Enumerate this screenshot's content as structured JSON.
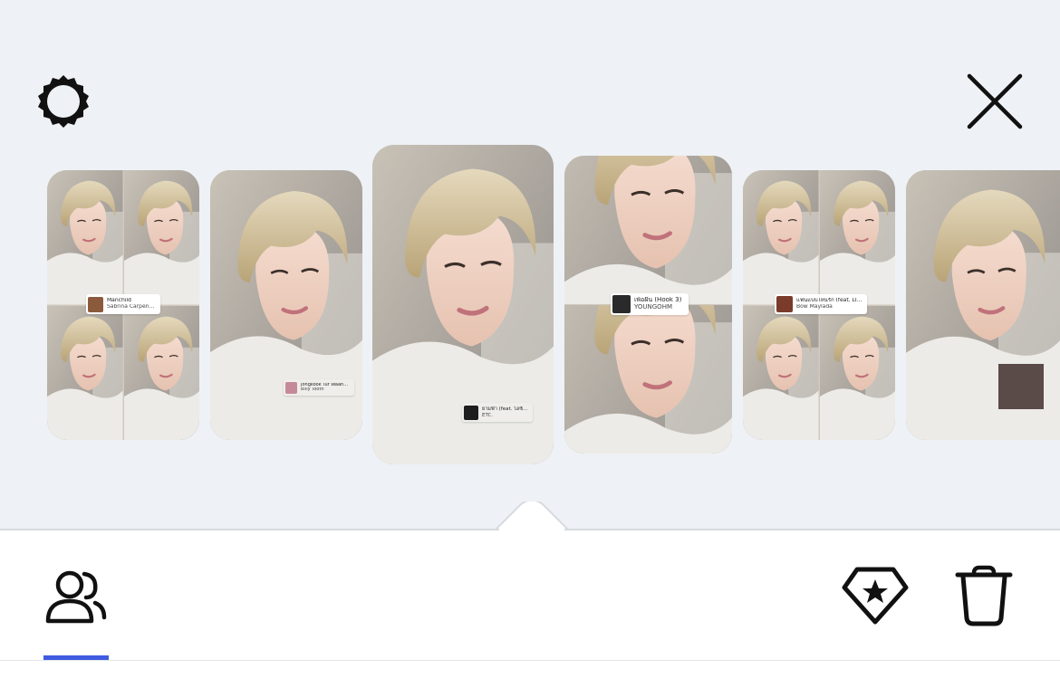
{
  "toolbar": {
    "settings_icon": "gear-icon",
    "close_icon": "close-icon"
  },
  "carousel": {
    "cards": [
      {
        "layout": "grid-4",
        "music": {
          "title": "Manchild",
          "artist": "Sabrina Carpenter"
        }
      },
      {
        "layout": "single",
        "music": {
          "title": "Jongkook Tur Waanack ...",
          "artist": "Billy Tooth"
        }
      },
      {
        "layout": "single",
        "selected": true,
        "music": {
          "title": "ยามฟ้า (feat. ไอซ์ บอย)",
          "artist": "ETC."
        }
      },
      {
        "layout": "split-2",
        "music": {
          "title": "เพ้อฝัน (Hook 3)",
          "artist": "YOUNGOHM"
        }
      },
      {
        "layout": "grid-4",
        "music": {
          "title": "แฟนแบบไหนรัก (feat. LIPTA)",
          "artist": "Bow Maylada"
        }
      },
      {
        "layout": "single",
        "sticker": "album-art-sticker"
      }
    ]
  },
  "bottom_bar": {
    "tabs": [
      {
        "icon": "people-icon",
        "active": true
      }
    ],
    "actions": [
      {
        "icon": "favorite-diamond-star-icon"
      },
      {
        "icon": "trash-icon"
      }
    ],
    "accent_color": "#3e5be0"
  },
  "colors": {
    "top_background": "#eef1f5",
    "sheet_background": "#ffffff",
    "icon_color": "#111111"
  }
}
